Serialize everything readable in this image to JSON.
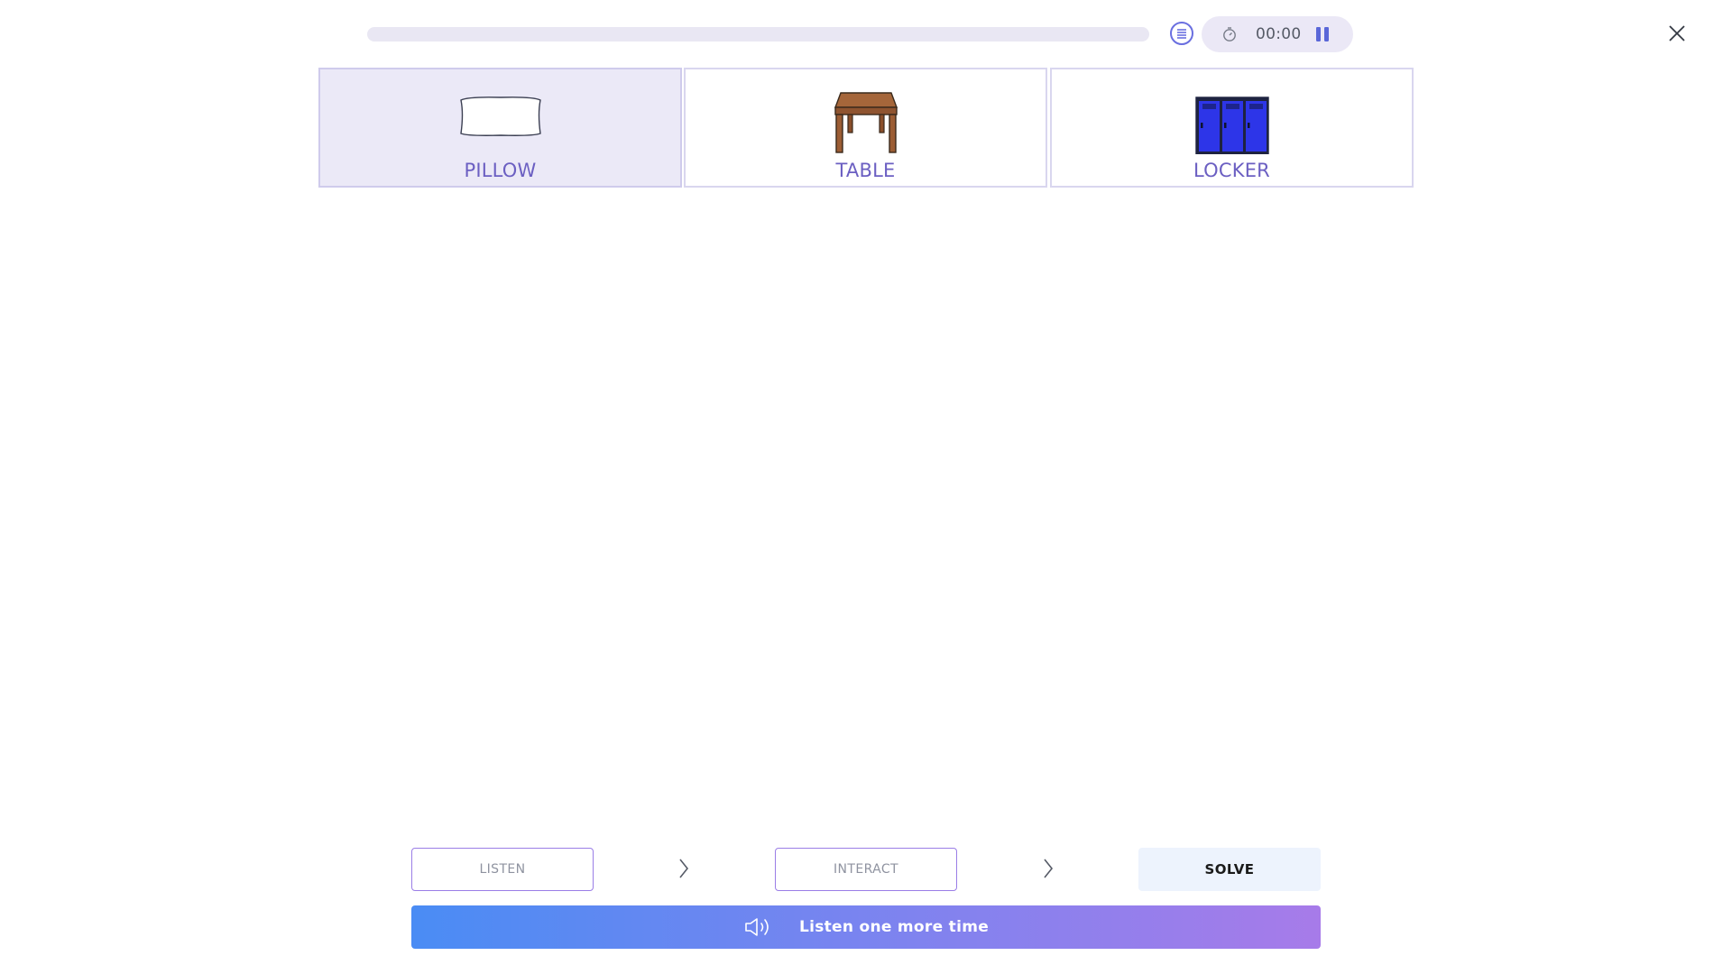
{
  "header": {
    "progress": 0,
    "timer": "00:00",
    "icons": {
      "menu": "list-icon",
      "timer": "stopwatch-icon",
      "pause": "pause-icon",
      "close": "close-icon"
    }
  },
  "cards": [
    {
      "label": "PILLOW",
      "image": "pillow-image",
      "selected": true
    },
    {
      "label": "TABLE",
      "image": "table-image",
      "selected": false
    },
    {
      "label": "LOCKER",
      "image": "locker-image",
      "selected": false
    }
  ],
  "steps": {
    "listen": "LISTEN",
    "interact": "INTERACT",
    "solve": "SOLVE",
    "active": "SOLVE"
  },
  "listen_again": {
    "label": "Listen one more time",
    "icon": "speaker-icon"
  },
  "colors": {
    "accent": "#6b5fc2",
    "selected_card_bg": "#ebe9f7",
    "button_gradient_start": "#4a8cf4",
    "button_gradient_end": "#a77be9"
  }
}
